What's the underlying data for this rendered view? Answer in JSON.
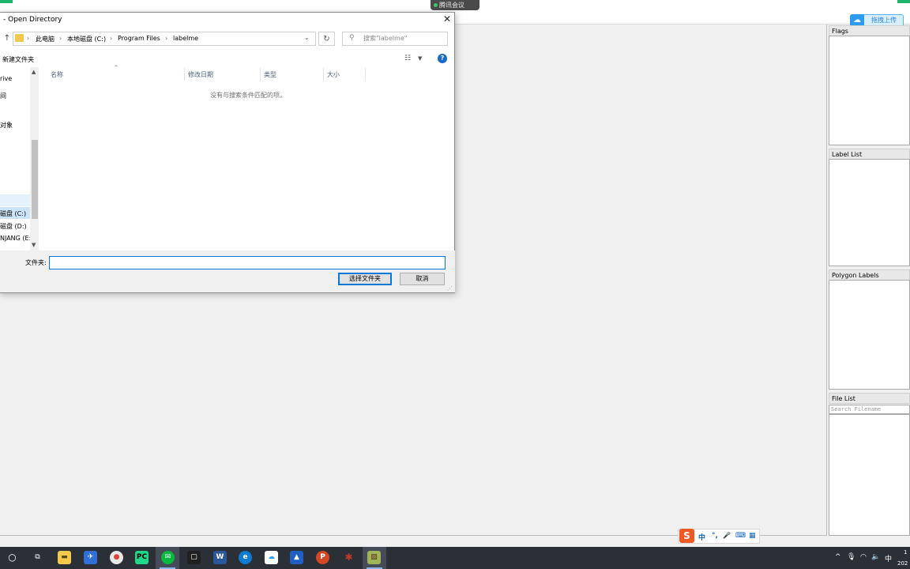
{
  "meeting": {
    "label": "腾讯会议"
  },
  "upload": {
    "label": "拖拽上传"
  },
  "docks": {
    "flags": "Flags",
    "label_list": "Label List",
    "polygon_labels": "Polygon Labels",
    "file_list": "File List",
    "file_search_placeholder": "Search Filename"
  },
  "dialog": {
    "title": "Open Directory",
    "close": "✕",
    "breadcrumb": [
      "此电脑",
      "本地磁盘 (C:)",
      "Program Files",
      "labelme"
    ],
    "search_placeholder": "搜索\"labelme\"",
    "new_folder": "新建文件夹",
    "nav_items": [
      "rive",
      "间",
      "对象",
      "磁盘 (C:)",
      "磁盘 (D:)",
      "NJANG (E:)"
    ],
    "columns": [
      "名称",
      "修改日期",
      "类型",
      "大小"
    ],
    "empty_message": "没有与搜索条件匹配的项。",
    "filename_label": "文件夹:",
    "filename_value": "",
    "ok": "选择文件夹",
    "cancel": "取消"
  },
  "ime": {
    "mode": "中",
    "punct": "°,",
    "mic": "🎤",
    "keyboard": "⌨",
    "menu": "▦"
  },
  "tray": {
    "ime_mode": "中",
    "clock_time": "1",
    "clock_date": "202"
  },
  "colors": {
    "accent": "#0078d7",
    "taskbar": "#2b2f36",
    "upload": "#2c9cf0"
  }
}
